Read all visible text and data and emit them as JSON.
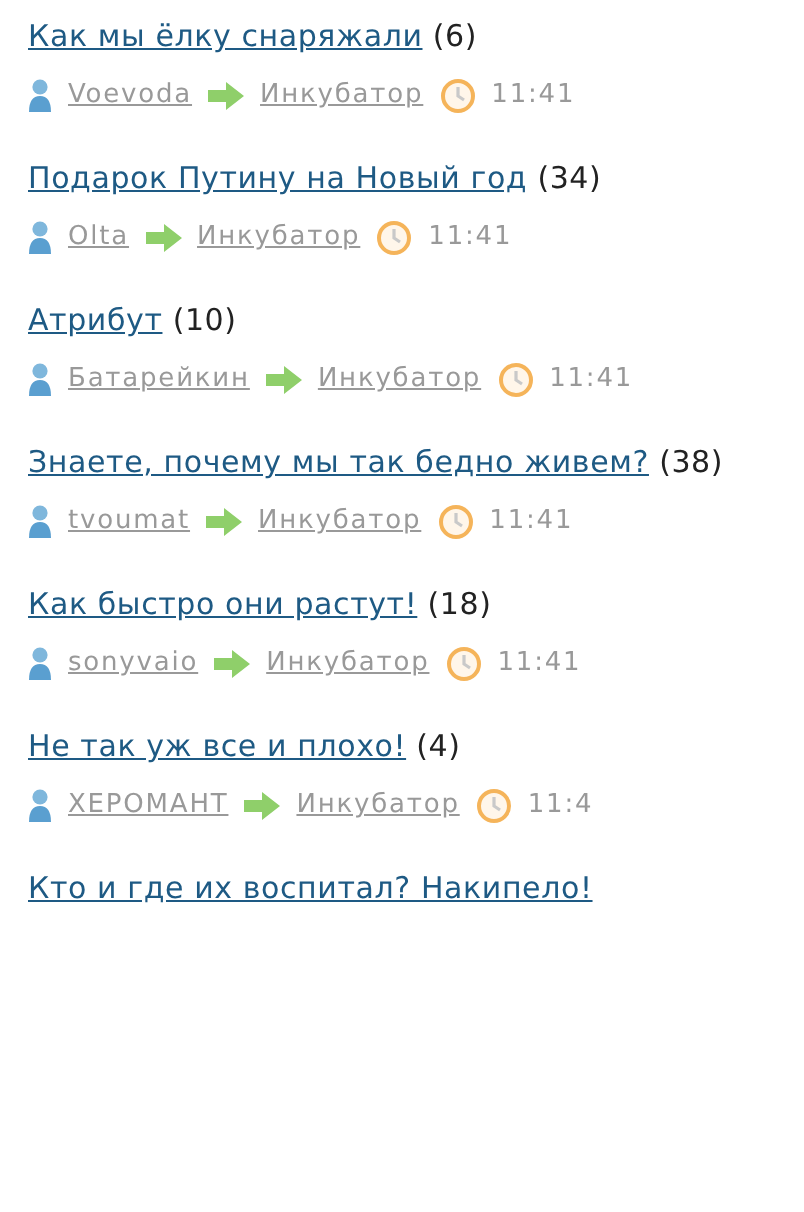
{
  "posts": [
    {
      "title": "Как мы ёлку снаряжали",
      "count": "(6)",
      "author": "Voevoda",
      "blog": "Инкубатор",
      "time": "11:41"
    },
    {
      "title": "Подарок Путину на Новый год",
      "count": "(34)",
      "author": "Olta",
      "blog": "Инкубатор",
      "time": "11:41"
    },
    {
      "title": "Атрибут",
      "count": "(10)",
      "author": "Батарейкин",
      "blog": "Инкубатор",
      "time": "11:41"
    },
    {
      "title": "Знаете, почему мы так бедно живем?",
      "count": "(38)",
      "author": "tvoumat",
      "blog": "Инкубатор",
      "time": "11:41"
    },
    {
      "title": "Как быстро они растут!",
      "count": "(18)",
      "author": "sonyvaio",
      "blog": "Инкубатор",
      "time": "11:41"
    },
    {
      "title": "Не так уж все и плохо!",
      "count": "(4)",
      "author": "ХЕРОМАНТ",
      "blog": "Инкубатор",
      "time": "11:4"
    },
    {
      "title": "Кто и где их воспитал? Накипело!"
    }
  ]
}
